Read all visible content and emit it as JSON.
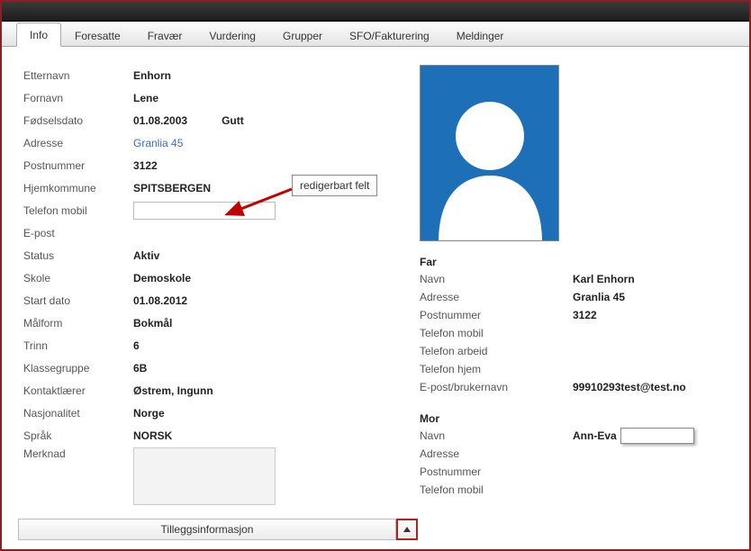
{
  "tabs": {
    "info": "Info",
    "foresatte": "Foresatte",
    "fravaer": "Fravær",
    "vurdering": "Vurdering",
    "grupper": "Grupper",
    "sfo": "SFO/Fakturering",
    "meldinger": "Meldinger"
  },
  "labels": {
    "etternavn": "Etternavn",
    "fornavn": "Fornavn",
    "fodselsdato": "Fødselsdato",
    "adresse": "Adresse",
    "postnummer": "Postnummer",
    "hjemkommune": "Hjemkommune",
    "telefon_mobil": "Telefon mobil",
    "epost": "E-post",
    "status": "Status",
    "skole": "Skole",
    "start_dato": "Start dato",
    "maalform": "Målform",
    "trinn": "Trinn",
    "klassegruppe": "Klassegruppe",
    "kontaktlaerer": "Kontaktlærer",
    "nasjonalitet": "Nasjonalitet",
    "spraak": "Språk",
    "merknad": "Merknad"
  },
  "student": {
    "etternavn": "Enhorn",
    "fornavn": "Lene",
    "fodselsdato": "01.08.2003",
    "kjonn": "Gutt",
    "adresse": "Granlia 45",
    "postnummer": "3122",
    "hjemkommune": "SPITSBERGEN",
    "telefon_mobil": "",
    "epost": "",
    "status": "Aktiv",
    "skole": "Demoskole",
    "start_dato": "01.08.2012",
    "maalform": "Bokmål",
    "trinn": "6",
    "klassegruppe": "6B",
    "kontaktlaerer": "Østrem, Ingunn",
    "nasjonalitet": "Norge",
    "spraak": "NORSK",
    "merknad": ""
  },
  "parent_labels": {
    "navn": "Navn",
    "adresse": "Adresse",
    "postnummer": "Postnummer",
    "telefon_mobil": "Telefon mobil",
    "telefon_arbeid": "Telefon arbeid",
    "telefon_hjem": "Telefon hjem",
    "epost_bruker": "E-post/brukernavn"
  },
  "far": {
    "title": "Far",
    "navn": "Karl Enhorn",
    "adresse": "Granlia 45",
    "postnummer": "3122",
    "telefon_mobil": "",
    "telefon_arbeid": "",
    "telefon_hjem": "",
    "epost_bruker": "99910293test@test.no"
  },
  "mor": {
    "title": "Mor",
    "navn_prefix": "Ann-Eva",
    "navn_input": "",
    "adresse": "",
    "postnummer": "",
    "telefon_mobil": ""
  },
  "tooltip": "redigerbart felt",
  "footer": {
    "tilleggs": "Tilleggsinformasjon"
  }
}
